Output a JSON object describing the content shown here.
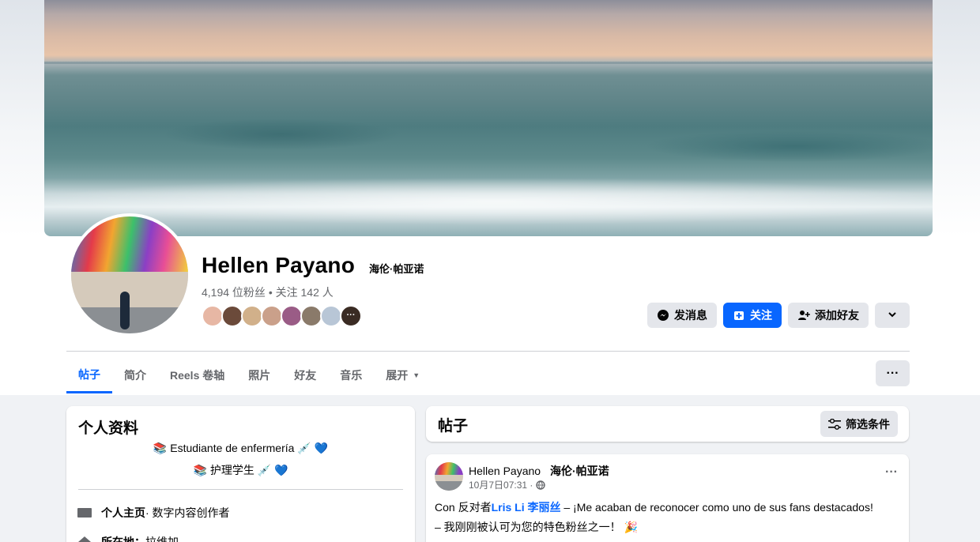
{
  "profile": {
    "name": "Hellen Payano",
    "alt_name": "海伦·帕亚诺",
    "stats": "4,194 位粉丝 • 关注 142 人",
    "friend_more_icon": "more-dots",
    "friend_avatar_colors": [
      "#e7b7a4",
      "#6b4a3a",
      "#d1b08a",
      "#caa08a",
      "#9a5c86",
      "#8a7a6a",
      "#b8c6d6"
    ]
  },
  "actions": {
    "message_label": "发消息",
    "follow_label": "关注",
    "add_friend_label": "添加好友",
    "message_icon": "messenger-icon",
    "follow_icon": "follow-icon",
    "add_friend_icon": "add-friend-icon",
    "dropdown_icon": "chevron-down-icon"
  },
  "tabs": [
    {
      "label": "帖子",
      "active": true
    },
    {
      "label": "简介"
    },
    {
      "label": "Reels  卷轴"
    },
    {
      "label": "照片"
    },
    {
      "label": "好友"
    },
    {
      "label": "音乐"
    },
    {
      "label": "展开"
    }
  ],
  "tabs_more": "···",
  "intro": {
    "title": "个人资料",
    "bio_line1": "📚 Estudiante de enfermería 💉 💙",
    "bio_line2": "📚 护理学生 💉 💙",
    "rows": [
      {
        "bold": "个人主页",
        "text": " · 数字内容创作者"
      },
      {
        "bold": "所在地：",
        "text": "拉维加"
      }
    ]
  },
  "posts": {
    "title": "帖子",
    "filter_label": "筛选条件",
    "filter_icon": "filter-sliders-icon"
  },
  "post": {
    "author": "Hellen Payano",
    "author_alt": "海伦·帕亚诺",
    "time": "10月7日07:31 ·",
    "more": "···",
    "text_line1_prefix": "Con    反对者",
    "link1": "Lris Li",
    "link2": "李丽丝",
    "text_line1_suffix": " – ¡Me acaban de reconocer como uno de sus fans destacados!",
    "text_line2": "– 我刚刚被认可为您的特色粉丝之一！ 🎉"
  },
  "colors": {
    "accent": "#0866ff",
    "secondary_text": "#65676b",
    "button_bg": "#e4e6eb"
  }
}
